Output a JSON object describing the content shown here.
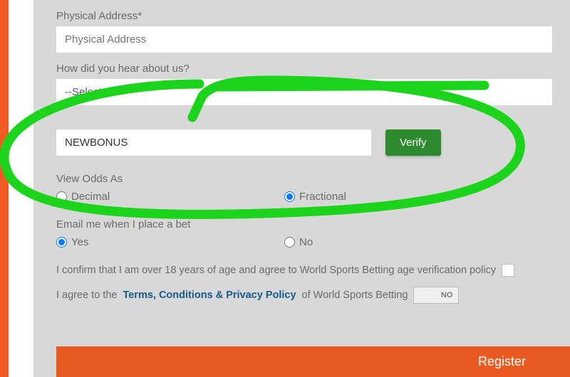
{
  "form": {
    "physical_address": {
      "label": "Physical Address*",
      "placeholder": "Physical Address"
    },
    "hear_about": {
      "label": "How did you hear about us?",
      "selected": "--Select--"
    },
    "bonus": {
      "value": "NEWBONUS",
      "verify_label": "Verify"
    },
    "view_odds": {
      "label": "View Odds As",
      "option1": "Decimal",
      "option2": "Fractional",
      "selected": "Fractional"
    },
    "email_bet": {
      "label": "Email me when I place a bet",
      "option1": "Yes",
      "option2": "No",
      "selected": "Yes"
    },
    "consent_age": "I confirm that I am over 18 years of age and agree to World Sports Betting age verification policy",
    "consent_terms_prefix": "I agree to the ",
    "consent_terms_link": "Terms, Conditions & Privacy Policy",
    "consent_terms_suffix": " of World Sports Betting ",
    "toggle_no": "NO",
    "register_label": "Register"
  }
}
